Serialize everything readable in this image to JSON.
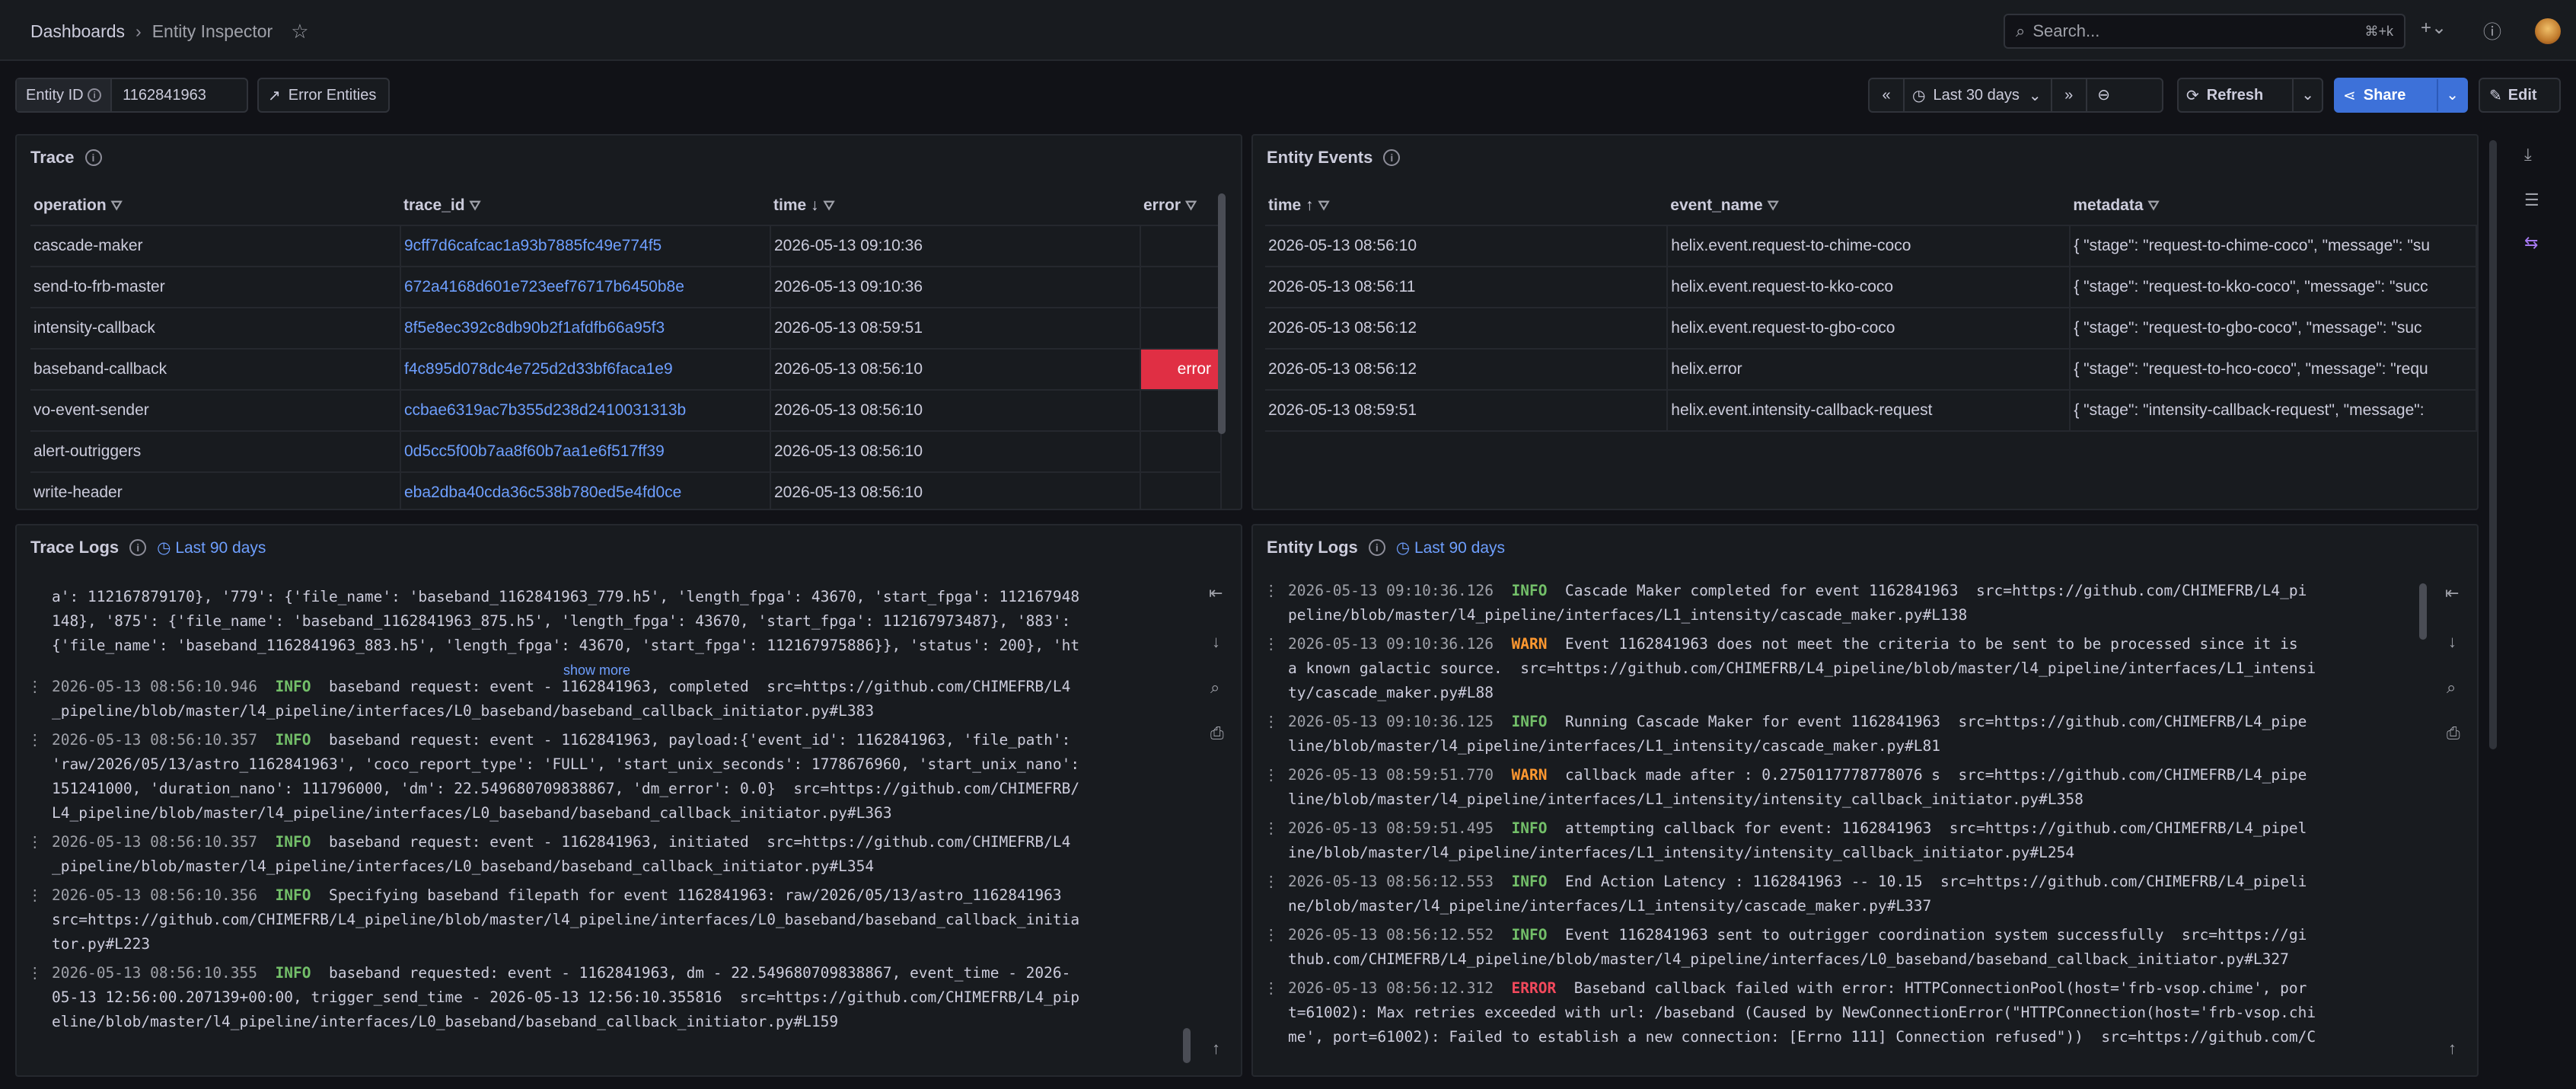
{
  "breadcrumb": {
    "root": "Dashboards",
    "current": "Entity Inspector"
  },
  "search": {
    "placeholder": "Search...",
    "shortcut": "⌘+k"
  },
  "controls": {
    "entity_label": "Entity ID",
    "entity_value": "1162841963",
    "error_entities": "Error Entities",
    "time_range": "Last 30 days",
    "refresh": "Refresh",
    "share": "Share",
    "edit": "Edit"
  },
  "trace": {
    "title": "Trace",
    "headers": [
      "operation",
      "trace_id",
      "time",
      "error"
    ],
    "rows": [
      [
        "cascade-maker",
        "9cff7d6cafcac1a93b7885fc49e774f5",
        "2026-05-13 09:10:36",
        ""
      ],
      [
        "send-to-frb-master",
        "672a4168d601e723eef76717b6450b8e",
        "2026-05-13 09:10:36",
        ""
      ],
      [
        "intensity-callback",
        "8f5e8ec392c8db90b2f1afdfb66a95f3",
        "2026-05-13 08:59:51",
        ""
      ],
      [
        "baseband-callback",
        "f4c895d078dc4e725d2d33bf6faca1e9",
        "2026-05-13 08:56:10",
        "error"
      ],
      [
        "vo-event-sender",
        "ccbae6319ac7b355d238d2410031313b",
        "2026-05-13 08:56:10",
        ""
      ],
      [
        "alert-outriggers",
        "0d5cc5f00b7aa8f60b7aa1e6f517ff39",
        "2026-05-13 08:56:10",
        ""
      ],
      [
        "write-header",
        "eba2dba40cda36c538b780ed5e4fd0ce",
        "2026-05-13 08:56:10",
        ""
      ]
    ]
  },
  "events": {
    "title": "Entity Events",
    "headers": [
      "time",
      "event_name",
      "metadata"
    ],
    "rows": [
      [
        "2026-05-13 08:56:10",
        "helix.event.request-to-chime-coco",
        "{ \"stage\": \"request-to-chime-coco\", \"message\": \"su"
      ],
      [
        "2026-05-13 08:56:11",
        "helix.event.request-to-kko-coco",
        "{ \"stage\": \"request-to-kko-coco\", \"message\": \"succ"
      ],
      [
        "2026-05-13 08:56:12",
        "helix.event.request-to-gbo-coco",
        "{ \"stage\": \"request-to-gbo-coco\", \"message\": \"suc"
      ],
      [
        "2026-05-13 08:56:12",
        "helix.error",
        "{ \"stage\": \"request-to-hco-coco\", \"message\": \"requ"
      ],
      [
        "2026-05-13 08:59:51",
        "helix.event.intensity-callback-request",
        "{ \"stage\": \"intensity-callback-request\", \"message\":"
      ]
    ]
  },
  "trace_logs": {
    "title": "Trace Logs",
    "range": "Last 90 days",
    "show_more": "show more",
    "lines": [
      "a': 112167879170}, '779': {'file_name': 'baseband_1162841963_779.h5', 'length_fpga': 43670, 'start_fpga': 112167948",
      "148}, '875': {'file_name': 'baseband_1162841963_875.h5', 'length_fpga': 43670, 'start_fpga': 112167973487}, '883':",
      "{'file_name': 'baseband_1162841963_883.h5', 'length_fpga': 43670, 'start_fpga': 112167975886}}, 'status': 200}, 'ht"
    ],
    "entries": [
      {
        "ts": "2026-05-13 08:56:10.946",
        "level": "INFO",
        "l1": "  baseband request: event - 1162841963, completed  src=https://github.com/CHIMEFRB/L4",
        "l2": "_pipeline/blob/master/l4_pipeline/interfaces/L0_baseband/baseband_callback_initiator.py#L383",
        "l3": ""
      },
      {
        "ts": "2026-05-13 08:56:10.357",
        "level": "INFO",
        "l1": "  baseband request: event - 1162841963, payload:{'event_id': 1162841963, 'file_path':",
        "l2": "'raw/2026/05/13/astro_1162841963', 'coco_report_type': 'FULL', 'start_unix_seconds': 1778676960, 'start_unix_nano':",
        "l3": "151241000, 'duration_nano': 111796000, 'dm': 22.549680709838867, 'dm_error': 0.0}  src=https://github.com/CHIMEFRB/",
        "l4": "L4_pipeline/blob/master/l4_pipeline/interfaces/L0_baseband/baseband_callback_initiator.py#L363"
      },
      {
        "ts": "2026-05-13 08:56:10.357",
        "level": "INFO",
        "l1": "  baseband request: event - 1162841963, initiated  src=https://github.com/CHIMEFRB/L4",
        "l2": "_pipeline/blob/master/l4_pipeline/interfaces/L0_baseband/baseband_callback_initiator.py#L354",
        "l3": ""
      },
      {
        "ts": "2026-05-13 08:56:10.356",
        "level": "INFO",
        "l1": "  Specifying baseband filepath for event 1162841963: raw/2026/05/13/astro_1162841963",
        "l2": "src=https://github.com/CHIMEFRB/L4_pipeline/blob/master/l4_pipeline/interfaces/L0_baseband/baseband_callback_initia",
        "l3": "tor.py#L223"
      },
      {
        "ts": "2026-05-13 08:56:10.355",
        "level": "INFO",
        "l1": "  baseband requested: event - 1162841963, dm - 22.549680709838867, event_time - 2026-",
        "l2": "05-13 12:56:00.207139+00:00, trigger_send_time - 2026-05-13 12:56:10.355816  src=https://github.com/CHIMEFRB/L4_pip",
        "l3": "eline/blob/master/l4_pipeline/interfaces/L0_baseband/baseband_callback_initiator.py#L159"
      }
    ]
  },
  "entity_logs": {
    "title": "Entity Logs",
    "range": "Last 90 days",
    "entries": [
      {
        "ts": "2026-05-13 09:10:36.126",
        "level": "INFO",
        "l1": "  Cascade Maker completed for event 1162841963  src=https://github.com/CHIMEFRB/L4_pi",
        "l2": "peline/blob/master/l4_pipeline/interfaces/L1_intensity/cascade_maker.py#L138",
        "l3": ""
      },
      {
        "ts": "2026-05-13 09:10:36.126",
        "level": "WARN",
        "l1": "  Event 1162841963 does not meet the criteria to be sent to be processed since it is",
        "l2": "a known galactic source.  src=https://github.com/CHIMEFRB/L4_pipeline/blob/master/l4_pipeline/interfaces/L1_intensi",
        "l3": "ty/cascade_maker.py#L88"
      },
      {
        "ts": "2026-05-13 09:10:36.125",
        "level": "INFO",
        "l1": "  Running Cascade Maker for event 1162841963  src=https://github.com/CHIMEFRB/L4_pipe",
        "l2": "line/blob/master/l4_pipeline/interfaces/L1_intensity/cascade_maker.py#L81",
        "l3": ""
      },
      {
        "ts": "2026-05-13 08:59:51.770",
        "level": "WARN",
        "l1": "  callback made after : 0.2750117778778076 s  src=https://github.com/CHIMEFRB/L4_pipe",
        "l2": "line/blob/master/l4_pipeline/interfaces/L1_intensity/intensity_callback_initiator.py#L358",
        "l3": ""
      },
      {
        "ts": "2026-05-13 08:59:51.495",
        "level": "INFO",
        "l1": "  attempting callback for event: 1162841963  src=https://github.com/CHIMEFRB/L4_pipel",
        "l2": "ine/blob/master/l4_pipeline/interfaces/L1_intensity/intensity_callback_initiator.py#L254",
        "l3": ""
      },
      {
        "ts": "2026-05-13 08:56:12.553",
        "level": "INFO",
        "l1": "  End Action Latency : 1162841963 -- 10.15  src=https://github.com/CHIMEFRB/L4_pipeli",
        "l2": "ne/blob/master/l4_pipeline/interfaces/L1_intensity/cascade_maker.py#L337",
        "l3": ""
      },
      {
        "ts": "2026-05-13 08:56:12.552",
        "level": "INFO",
        "l1": "  Event 1162841963 sent to outrigger coordination system successfully  src=https://gi",
        "l2": "thub.com/CHIMEFRB/L4_pipeline/blob/master/l4_pipeline/interfaces/L0_baseband/baseband_callback_initiator.py#L327",
        "l3": ""
      },
      {
        "ts": "2026-05-13 08:56:12.312",
        "level": "ERROR",
        "l1": "  Baseband callback failed with error: HTTPConnectionPool(host='frb-vsop.chime', por",
        "l2": "t=61002): Max retries exceeded with url: /baseband (Caused by NewConnectionError(\"HTTPConnection(host='frb-vsop.chi",
        "l3": "me', port=61002): Failed to establish a new connection: [Errno 111] Connection refused\"))  src=https://github.com/C"
      }
    ]
  }
}
